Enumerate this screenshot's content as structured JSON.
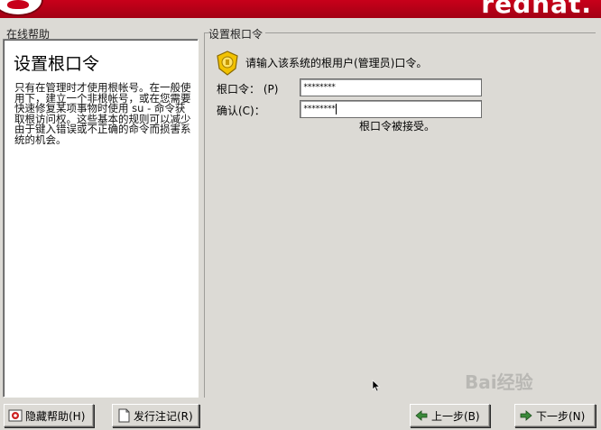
{
  "banner": {
    "brand": "redhat."
  },
  "help": {
    "section_label": "在线帮助",
    "heading": "设置根口令",
    "body": "只有在管理时才使用根帐号。在一般使用下，建立一个非根帐号，或在您需要快速修复某项事物时使用 su - 命令获取根访问权。这些基本的规则可以减少由于键入错误或不正确的命令而损害系统的机会。"
  },
  "main": {
    "section_label": "设置根口令",
    "instruction": "请输入该系统的根用户(管理员)口令。",
    "root_label": "根口令：  (P)",
    "root_value": "********",
    "confirm_label": "确认(C)：",
    "confirm_value": "********",
    "status": "根口令被接受。"
  },
  "buttons": {
    "hide_help": "隐藏帮助(H)",
    "release_notes": "发行注记(R)",
    "back": "上一步(B)",
    "next": "下一步(N)"
  },
  "icons": {
    "badge": "shield-badge-icon",
    "hide_help": "help-icon",
    "release_notes": "document-icon",
    "back": "arrow-left-icon",
    "next": "arrow-right-icon"
  },
  "colors": {
    "banner": "#b3001a",
    "window": "#dcdad5"
  },
  "watermark": "Bai经验"
}
